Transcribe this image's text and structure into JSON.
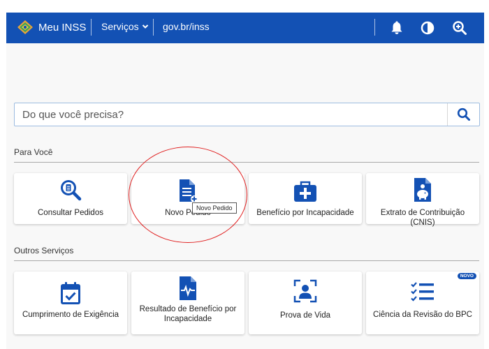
{
  "header": {
    "brand": "Meu INSS",
    "services_label": "Serviços",
    "govbr_label": "gov.br/inss",
    "icons": [
      "bell-icon",
      "contrast-icon",
      "zoom-in-icon"
    ],
    "color": "#1351b4"
  },
  "search": {
    "placeholder": "Do que você precisa?"
  },
  "sections": {
    "para_voce": {
      "title": "Para Você",
      "cards": [
        {
          "label": "Consultar Pedidos",
          "icon": "search-document-icon"
        },
        {
          "label": "Novo Pedido",
          "icon": "new-document-icon"
        },
        {
          "label": "Benefício por Incapacidade",
          "icon": "medical-kit-icon"
        },
        {
          "label": "Extrato de Contribuição (CNIS)",
          "icon": "piggy-bank-document-icon"
        }
      ]
    },
    "outros": {
      "title": "Outros Serviços",
      "cards": [
        {
          "label": "Cumprimento de Exigência",
          "icon": "calendar-check-icon"
        },
        {
          "label": "Resultado de Benefício por Incapacidade",
          "icon": "heartbeat-document-icon"
        },
        {
          "label": "Prova de Vida",
          "icon": "face-scan-icon"
        },
        {
          "label": "Ciência da Revisão do BPC",
          "icon": "checklist-icon",
          "badge": "NOVO"
        }
      ]
    }
  },
  "tooltip": "Novo Pedido",
  "accent": "#1351b4",
  "annotation_color": "#e02020"
}
